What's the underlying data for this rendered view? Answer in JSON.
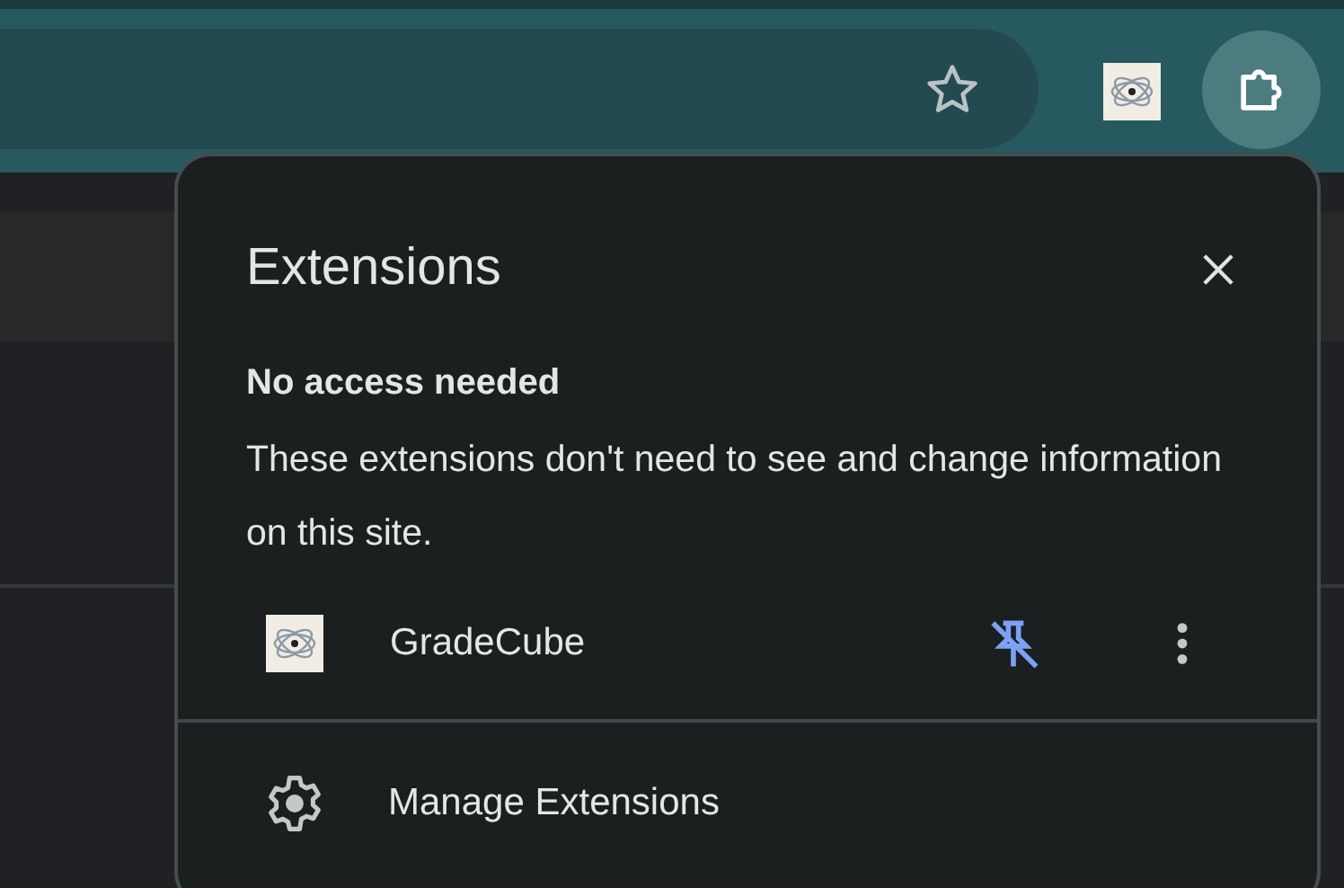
{
  "popup": {
    "title": "Extensions",
    "section_title": "No access needed",
    "section_text": "These extensions don't need to see and change information on this site.",
    "extensions": [
      {
        "name": "GradeCube",
        "pinned": true
      }
    ],
    "footer": {
      "label": "Manage Extensions"
    }
  }
}
